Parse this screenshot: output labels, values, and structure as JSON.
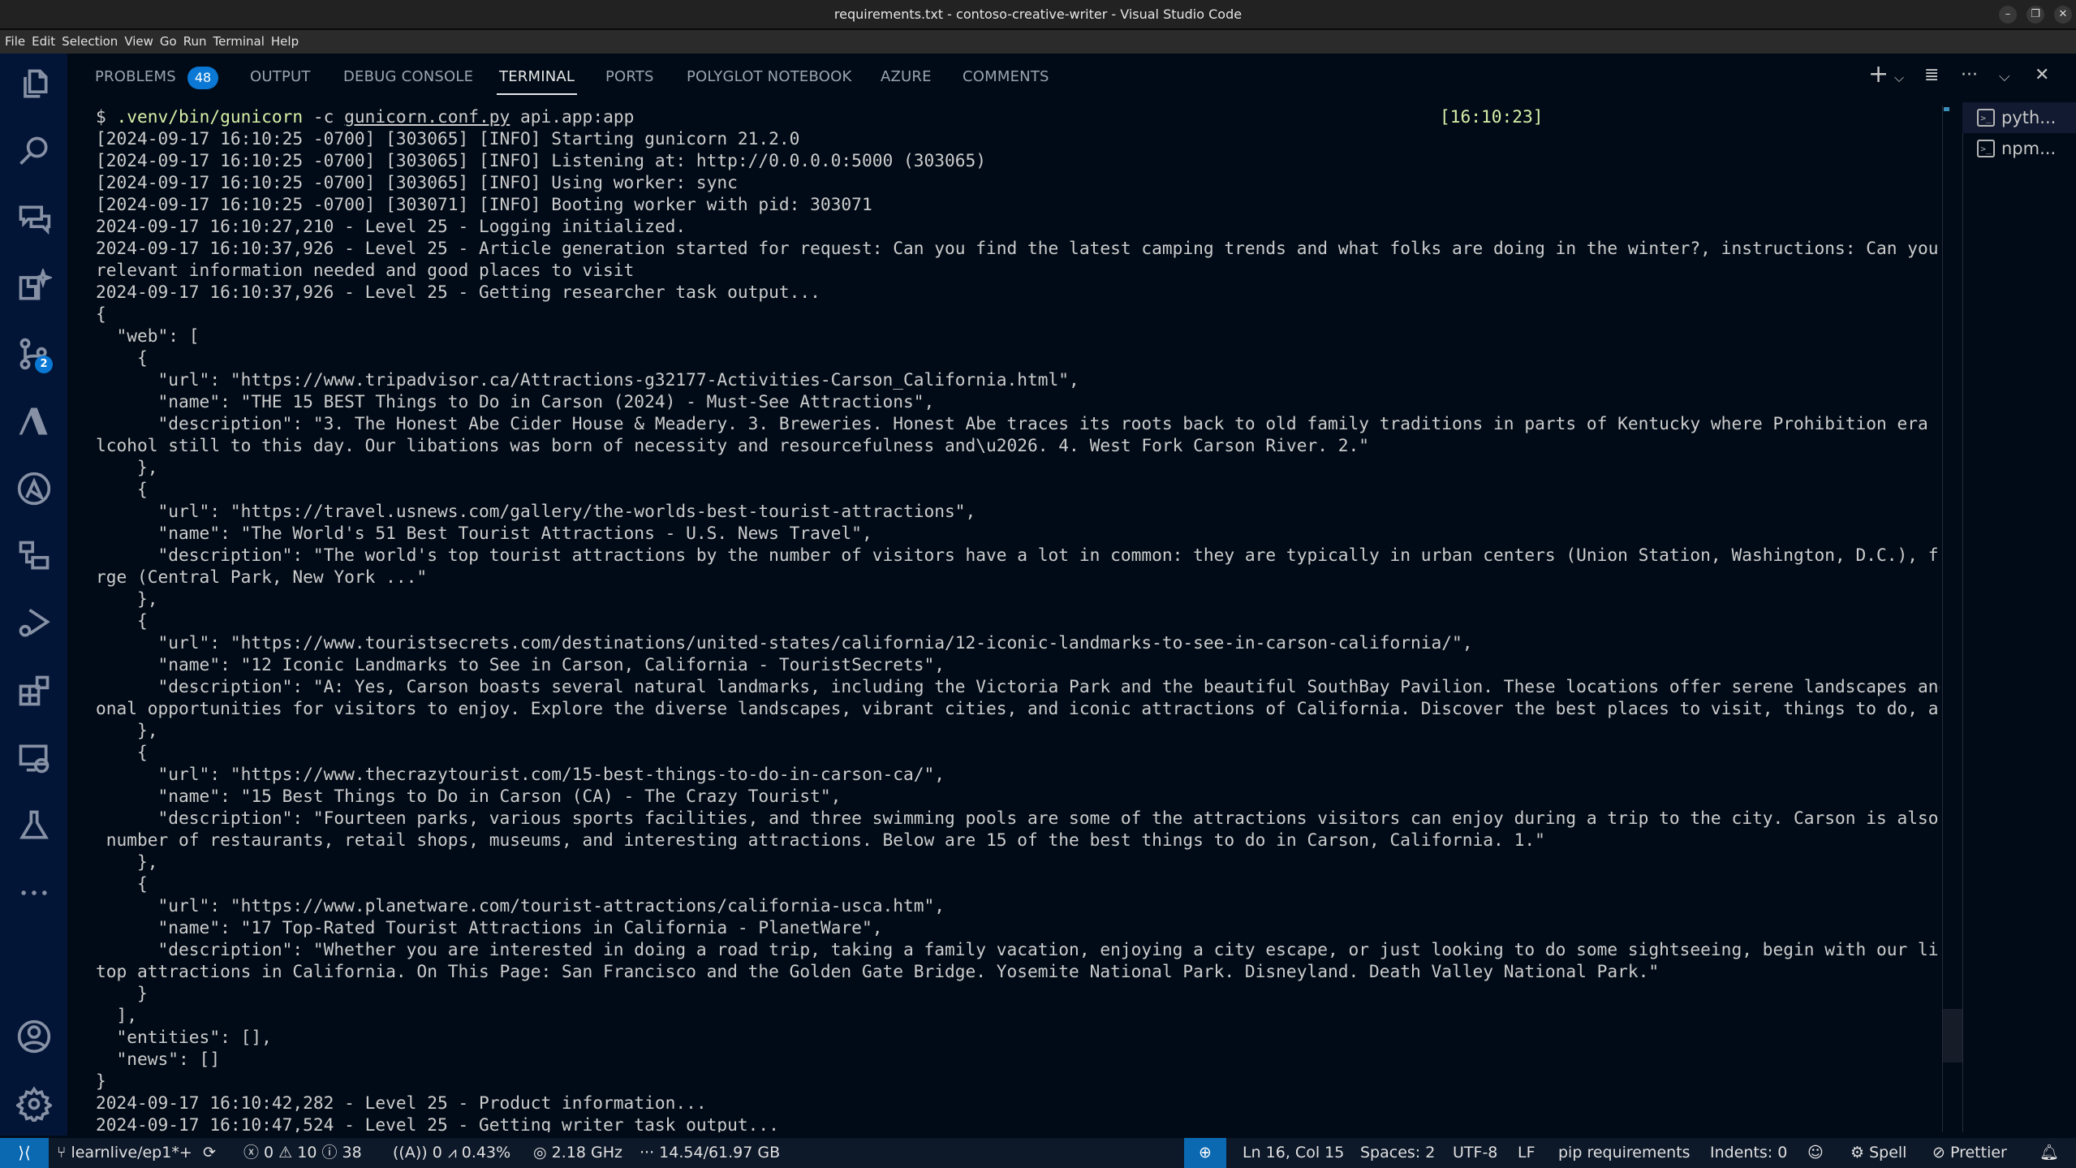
{
  "window": {
    "title": "requirements.txt - contoso-creative-writer - Visual Studio Code",
    "controls": [
      "minimize",
      "restore",
      "close"
    ]
  },
  "menu": [
    "File",
    "Edit",
    "Selection",
    "View",
    "Go",
    "Run",
    "Terminal",
    "Help"
  ],
  "activity_bar": {
    "items": [
      {
        "icon": "explorer-icon"
      },
      {
        "icon": "search-icon"
      },
      {
        "icon": "chat-icon"
      },
      {
        "icon": "copilot-icon"
      },
      {
        "icon": "source-control-icon",
        "badge": "2"
      },
      {
        "icon": "azure-icon"
      },
      {
        "icon": "ansible-icon"
      },
      {
        "icon": "remote-explorer-icon"
      },
      {
        "icon": "run-debug-icon"
      },
      {
        "icon": "extensions-icon"
      },
      {
        "icon": "remote-desktop-icon"
      },
      {
        "icon": "testing-icon"
      },
      {
        "icon": "more-icon"
      }
    ],
    "bottom": [
      {
        "icon": "account-icon"
      },
      {
        "icon": "settings-gear-icon"
      }
    ]
  },
  "panel": {
    "tabs": [
      {
        "label": "PROBLEMS",
        "badge": "48"
      },
      {
        "label": "OUTPUT"
      },
      {
        "label": "DEBUG CONSOLE"
      },
      {
        "label": "TERMINAL",
        "active": true
      },
      {
        "label": "PORTS"
      },
      {
        "label": "POLYGLOT NOTEBOOK"
      },
      {
        "label": "AZURE"
      },
      {
        "label": "COMMENTS"
      }
    ],
    "actions": [
      "new-terminal",
      "terminal-dropdown",
      "clear",
      "more",
      "maximize",
      "close"
    ]
  },
  "terminal": {
    "prompt": "$ ",
    "command": ".venv/bin/gunicorn",
    "args_pre": " -c ",
    "args_file": "gunicorn.conf.py",
    "args_post": " api.app:app",
    "timestamp": "[16:10:23]",
    "lines": [
      "[2024-09-17 16:10:25 -0700] [303065] [INFO] Starting gunicorn 21.2.0",
      "[2024-09-17 16:10:25 -0700] [303065] [INFO] Listening at: http://0.0.0.0:5000 (303065)",
      "[2024-09-17 16:10:25 -0700] [303065] [INFO] Using worker: sync",
      "[2024-09-17 16:10:25 -0700] [303071] [INFO] Booting worker with pid: 303071",
      "2024-09-17 16:10:27,210 - Level 25 - Logging initialized.",
      "2024-09-17 16:10:37,926 - Level 25 - Article generation started for request: Can you find the latest camping trends and what folks are doing in the winter?, instructions: Can you find the",
      "relevant information needed and good places to visit",
      "2024-09-17 16:10:37,926 - Level 25 - Getting researcher task output...",
      "{",
      "  \"web\": [",
      "    {",
      "      \"url\": \"https://www.tripadvisor.ca/Attractions-g32177-Activities-Carson_California.html\",",
      "      \"name\": \"THE 15 BEST Things to Do in Carson (2024) - Must-See Attractions\",",
      "      \"description\": \"3. The Honest Abe Cider House & Meadery. 3. Breweries. Honest Abe traces its roots back to old family traditions in parts of Kentucky where Prohibition era laws ban a",
      "lcohol still to this day. Our libations was born of necessity and resourcefulness and\\u2026. 4. West Fork Carson River. 2.\"",
      "    },",
      "    {",
      "      \"url\": \"https://travel.usnews.com/gallery/the-worlds-best-tourist-attractions\",",
      "      \"name\": \"The World's 51 Best Tourist Attractions - U.S. News Travel\",",
      "      \"description\": \"The world's top tourist attractions by the number of visitors have a lot in common: they are typically in urban centers (Union Station, Washington, D.C.), free of cha",
      "rge (Central Park, New York ...\"",
      "    },",
      "    {",
      "      \"url\": \"https://www.touristsecrets.com/destinations/united-states/california/12-iconic-landmarks-to-see-in-carson-california/\",",
      "      \"name\": \"12 Iconic Landmarks to See in Carson, California - TouristSecrets\",",
      "      \"description\": \"A: Yes, Carson boasts several natural landmarks, including the Victoria Park and the beautiful SouthBay Pavilion. These locations offer serene landscapes and recreati",
      "onal opportunities for visitors to enjoy. Explore the diverse landscapes, vibrant cities, and iconic attractions of California. Discover the best places to visit, things to do, and ...\"",
      "    },",
      "    {",
      "      \"url\": \"https://www.thecrazytourist.com/15-best-things-to-do-in-carson-ca/\",",
      "      \"name\": \"15 Best Things to Do in Carson (CA) - The Crazy Tourist\",",
      "      \"description\": \"Fourteen parks, various sports facilities, and three swimming pools are some of the attractions visitors can enjoy during a trip to the city. Carson is also home to a",
      " number of restaurants, retail shops, museums, and interesting attractions. Below are 15 of the best things to do in Carson, California. 1.\"",
      "    },",
      "    {",
      "      \"url\": \"https://www.planetware.com/tourist-attractions/california-usca.htm\",",
      "      \"name\": \"17 Top-Rated Tourist Attractions in California - PlanetWare\",",
      "      \"description\": \"Whether you are interested in doing a road trip, taking a family vacation, enjoying a city escape, or just looking to do some sightseeing, begin with our list of the",
      "top attractions in California. On This Page: San Francisco and the Golden Gate Bridge. Yosemite National Park. Disneyland. Death Valley National Park.\"",
      "    }",
      "  ],",
      "  \"entities\": [],",
      "  \"news\": []",
      "}",
      "2024-09-17 16:10:42,282 - Level 25 - Product information...",
      "2024-09-17 16:10:47,524 - Level 25 - Getting writer task output..."
    ]
  },
  "terminal_list": [
    {
      "label": "pyth...",
      "selected": true
    },
    {
      "label": "npm..."
    }
  ],
  "status_bar": {
    "branch": "learnlive/ep1*+",
    "errors": "0",
    "warnings": "10",
    "infos": "38",
    "ports": "0",
    "cpu": "0.43%",
    "freq": "2.18 GHz",
    "memory": "14.54/61.97 GB",
    "position": "Ln 16, Col 15",
    "spaces": "Spaces: 2",
    "encoding": "UTF-8",
    "eol": "LF",
    "language": "pip requirements",
    "indents": "Indents: 0",
    "spell": "Spell",
    "prettier": "Prettier"
  },
  "colors": {
    "accent": "#0a78d4",
    "activity_bg": "#031537",
    "terminal_bg": "#010b17",
    "command_green": "#d7efa7"
  }
}
